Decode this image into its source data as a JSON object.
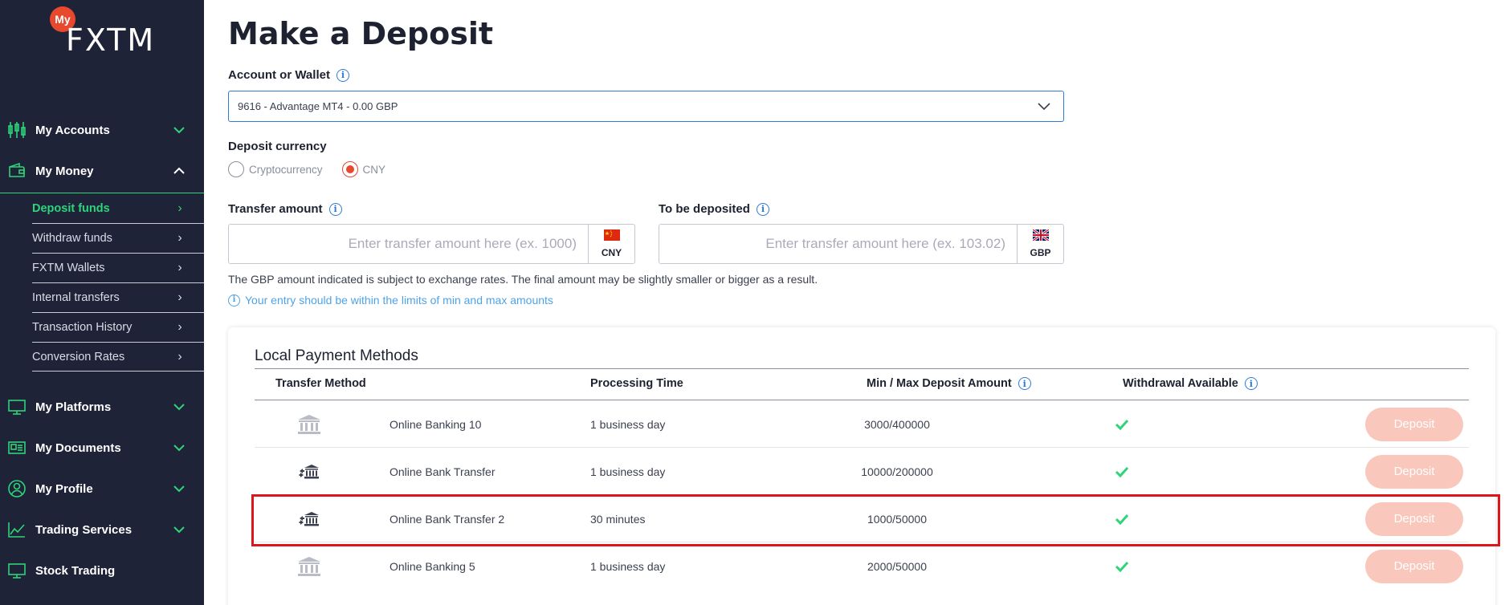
{
  "sidebar": {
    "logo": {
      "badge": "My",
      "text": "FXTM"
    },
    "nav": [
      {
        "label": "My Accounts",
        "icon": "candlestick-icon",
        "expanded": false
      },
      {
        "label": "My Money",
        "icon": "wallet-icon",
        "expanded": true
      },
      {
        "label": "My Platforms",
        "icon": "monitor-icon",
        "expanded": false
      },
      {
        "label": "My Documents",
        "icon": "id-card-icon",
        "expanded": false
      },
      {
        "label": "My Profile",
        "icon": "user-circle-icon",
        "expanded": false
      },
      {
        "label": "Trading Services",
        "icon": "chart-line-icon",
        "expanded": false
      },
      {
        "label": "Stock Trading",
        "icon": "monitor-icon",
        "expanded": false
      }
    ],
    "money_sub": [
      {
        "label": "Deposit funds",
        "active": true
      },
      {
        "label": "Withdraw funds",
        "active": false
      },
      {
        "label": "FXTM Wallets",
        "active": false
      },
      {
        "label": "Internal transfers",
        "active": false
      },
      {
        "label": "Transaction History",
        "active": false
      },
      {
        "label": "Conversion Rates",
        "active": false
      }
    ],
    "accent_color": "#2ed47a"
  },
  "main": {
    "title": "Make a Deposit",
    "account_label": "Account or Wallet",
    "account_value": "9616 - Advantage MT4 - 0.00 GBP",
    "currency_label": "Deposit currency",
    "currency_options": [
      {
        "label": "Cryptocurrency",
        "checked": false
      },
      {
        "label": "CNY",
        "checked": true
      }
    ],
    "transfer": {
      "label": "Transfer amount",
      "placeholder": "Enter transfer amount here (ex. 1000)",
      "currency": "CNY",
      "flag": "china-flag-icon"
    },
    "deposited": {
      "label": "To be deposited",
      "placeholder": "Enter transfer amount here (ex. 103.02)",
      "currency": "GBP",
      "flag": "uk-flag-icon"
    },
    "note": "The GBP amount indicated is subject to exchange rates. The final amount may be slightly smaller or bigger as a result.",
    "hint": "Your entry should be within the limits of min and max amounts",
    "methods": {
      "title": "Local Payment Methods",
      "headers": {
        "method": "Transfer Method",
        "time": "Processing Time",
        "amount": "Min / Max Deposit Amount",
        "withdrawal": "Withdrawal Available"
      },
      "rows": [
        {
          "name": "Online Banking 10",
          "time": "1 business day",
          "amount": "3000/400000",
          "icon": "bank-icon",
          "button": "Deposit"
        },
        {
          "name": "Online Bank Transfer",
          "time": "1 business day",
          "amount": "10000/200000",
          "icon": "bank-transfer-icon",
          "button": "Deposit"
        },
        {
          "name": "Online Bank Transfer 2",
          "time": "30 minutes",
          "amount": "1000/50000",
          "icon": "bank-transfer-icon",
          "button": "Deposit"
        },
        {
          "name": "Online Banking 5",
          "time": "1 business day",
          "amount": "2000/50000",
          "icon": "bank-icon",
          "button": "Deposit"
        }
      ]
    },
    "colors": {
      "primary_blue": "#2f7ad9",
      "radio_checked": "#e8482e",
      "deposit_button": "#f9c7bb",
      "check_green": "#2ed47a",
      "highlight_red": "#e0151b"
    }
  }
}
